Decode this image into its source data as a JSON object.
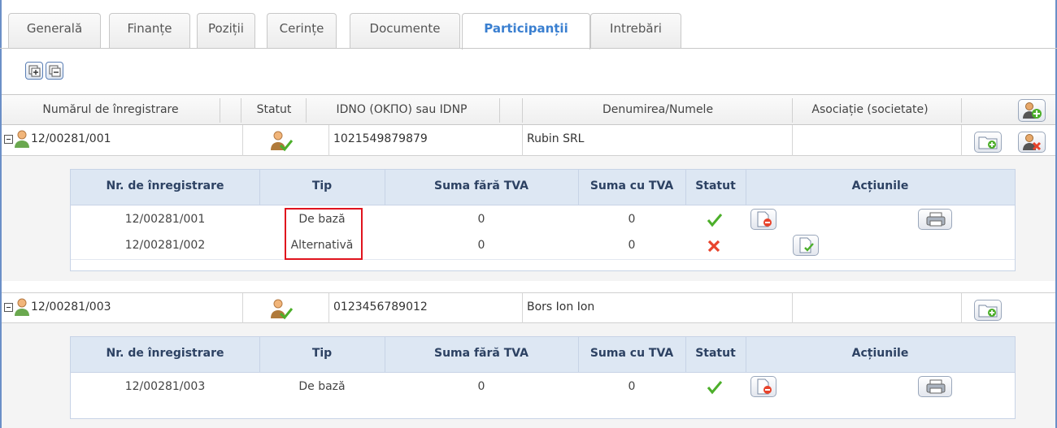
{
  "tabs": [
    {
      "label": "Generală"
    },
    {
      "label": "Finanțe"
    },
    {
      "label": "Poziții"
    },
    {
      "label": "Cerințe"
    },
    {
      "label": "Documente"
    },
    {
      "label": "Participanții"
    },
    {
      "label": "Intrebări"
    }
  ],
  "active_tab": "Participanții",
  "grid": {
    "headers": {
      "reg": "Numărul de înregistrare",
      "status": "Statut",
      "idno": "IDNO (OKПO) sau IDNP",
      "name": "Denumirea/Numele",
      "assoc": "Asociație (societate)"
    },
    "participants": [
      {
        "reg": "12/00281/001",
        "idno": "1021549879879",
        "name": "Rubin SRL",
        "assoc": ""
      },
      {
        "reg": "12/00281/003",
        "idno": "0123456789012",
        "name": "Bors Ion Ion",
        "assoc": ""
      }
    ]
  },
  "subgrid": {
    "headers": {
      "reg": "Nr. de înregistrare",
      "type": "Tip",
      "sum_no_vat": "Suma fără TVA",
      "sum_vat": "Suma cu TVA",
      "status": "Statut",
      "actions": "Acțiunile"
    },
    "p1_rows": [
      {
        "reg": "12/00281/001",
        "type": "De bază",
        "sum_no_vat": "0",
        "sum_vat": "0",
        "status": "ok"
      },
      {
        "reg": "12/00281/002",
        "type": "Alternativă",
        "sum_no_vat": "0",
        "sum_vat": "0",
        "status": "error"
      }
    ],
    "p2_rows": [
      {
        "reg": "12/00281/003",
        "type": "De bază",
        "sum_no_vat": "0",
        "sum_vat": "0",
        "status": "ok"
      }
    ]
  },
  "colors": {
    "accent": "#3a7fd0",
    "ok": "#4caf2a",
    "error": "#e8442c",
    "highlight": "#e0141e"
  }
}
